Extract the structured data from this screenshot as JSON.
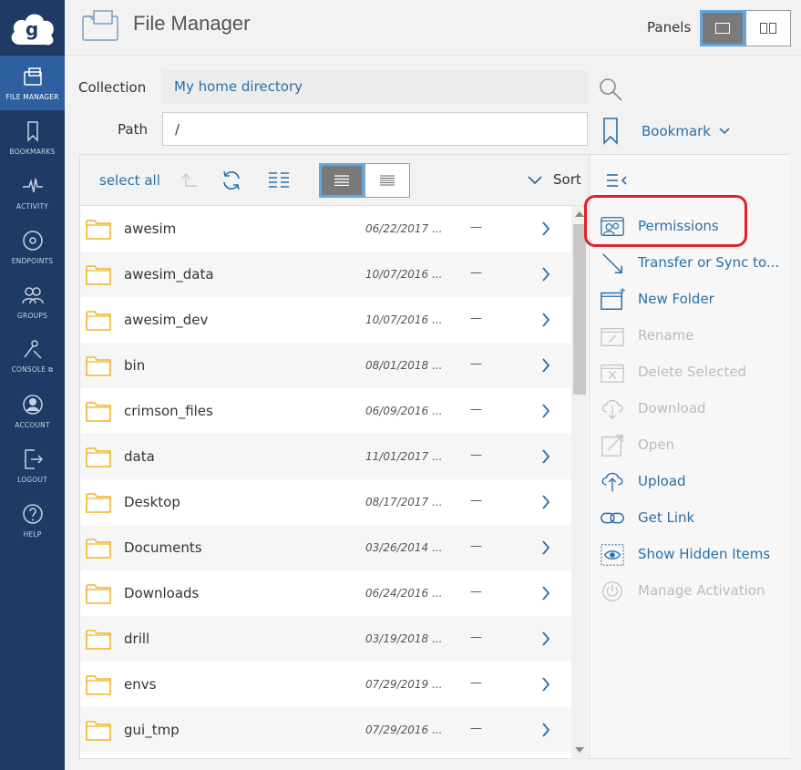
{
  "nav": {
    "items": [
      {
        "label": "FILE MANAGER",
        "icon": "folder-icon",
        "active": true
      },
      {
        "label": "BOOKMARKS",
        "icon": "bookmark-icon"
      },
      {
        "label": "ACTIVITY",
        "icon": "activity-icon"
      },
      {
        "label": "ENDPOINTS",
        "icon": "endpoint-icon"
      },
      {
        "label": "GROUPS",
        "icon": "groups-icon"
      },
      {
        "label": "CONSOLE ⧉",
        "icon": "console-icon"
      },
      {
        "label": "ACCOUNT",
        "icon": "account-icon"
      },
      {
        "label": "LOGOUT",
        "icon": "logout-icon"
      },
      {
        "label": "HELP",
        "icon": "help-icon"
      }
    ]
  },
  "header": {
    "title": "File Manager",
    "panels_label": "Panels"
  },
  "collection": {
    "label": "Collection",
    "value": "My home directory"
  },
  "path": {
    "label": "Path",
    "value": "/"
  },
  "bookmark": {
    "label": "Bookmark"
  },
  "toolbar": {
    "select_all": "select all",
    "sort_label": "Sort"
  },
  "files": [
    {
      "name": "awesim",
      "date": "06/22/2017 ...",
      "size": "—"
    },
    {
      "name": "awesim_data",
      "date": "10/07/2016 ...",
      "size": "—"
    },
    {
      "name": "awesim_dev",
      "date": "10/07/2016 ...",
      "size": "—"
    },
    {
      "name": "bin",
      "date": "08/01/2018 ...",
      "size": "—"
    },
    {
      "name": "crimson_files",
      "date": "06/09/2016 ...",
      "size": "—"
    },
    {
      "name": "data",
      "date": "11/01/2017 ...",
      "size": "—"
    },
    {
      "name": "Desktop",
      "date": "08/17/2017 ...",
      "size": "—"
    },
    {
      "name": "Documents",
      "date": "03/26/2014 ...",
      "size": "—"
    },
    {
      "name": "Downloads",
      "date": "06/24/2016 ...",
      "size": "—"
    },
    {
      "name": "drill",
      "date": "03/19/2018 ...",
      "size": "—"
    },
    {
      "name": "envs",
      "date": "07/29/2019 ...",
      "size": "—"
    },
    {
      "name": "gui_tmp",
      "date": "07/29/2016 ...",
      "size": "—"
    }
  ],
  "actions": [
    {
      "label": "Permissions",
      "icon": "permissions-icon",
      "enabled": true
    },
    {
      "label": "Transfer or Sync to...",
      "icon": "transfer-icon",
      "enabled": true
    },
    {
      "label": "New Folder",
      "icon": "new-folder-icon",
      "enabled": true
    },
    {
      "label": "Rename",
      "icon": "rename-icon",
      "enabled": false
    },
    {
      "label": "Delete Selected",
      "icon": "delete-icon",
      "enabled": false
    },
    {
      "label": "Download",
      "icon": "download-icon",
      "enabled": false
    },
    {
      "label": "Open",
      "icon": "open-icon",
      "enabled": false
    },
    {
      "label": "Upload",
      "icon": "upload-icon",
      "enabled": true
    },
    {
      "label": "Get Link",
      "icon": "link-icon",
      "enabled": true
    },
    {
      "label": "Show Hidden Items",
      "icon": "eye-icon",
      "enabled": true
    },
    {
      "label": "Manage Activation",
      "icon": "power-icon",
      "enabled": false
    }
  ],
  "colors": {
    "nav_bg": "#1f3a64",
    "nav_active": "#2e5fa0",
    "link": "#2a6fa8",
    "disabled": "#bbbbbb",
    "folder": "#f0b429",
    "highlight": "#e0202a"
  }
}
